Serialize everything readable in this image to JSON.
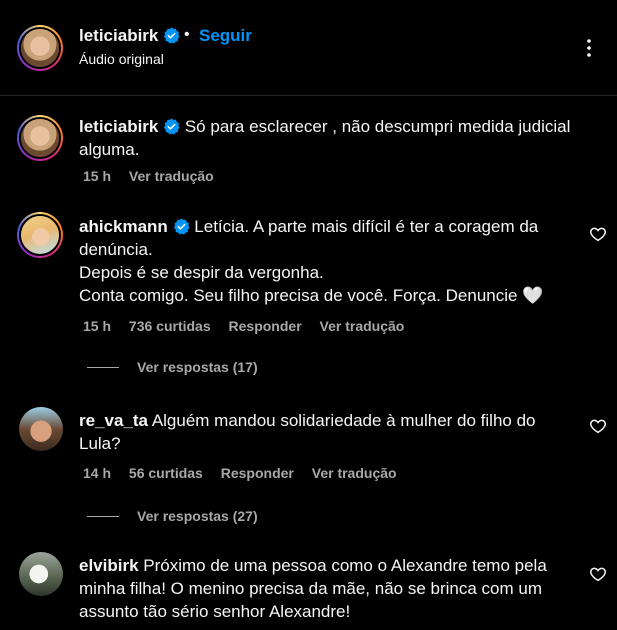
{
  "header": {
    "username": "leticiabirk",
    "follow_label": "Seguir",
    "separator": "•",
    "subtitle": "Áudio original",
    "verified_icon": "verified-badge-icon",
    "more_icon": "more-options-icon"
  },
  "comments": [
    {
      "username": "leticiabirk",
      "verified": true,
      "text": "Só para esclarecer , não descumpri medida judicial alguma.",
      "time": "15 h",
      "likes": "",
      "reply_label": "",
      "translate_label": "Ver tradução",
      "replies_label": ""
    },
    {
      "username": "ahickmann",
      "verified": true,
      "text": "Letícia. A parte mais difícil é ter a coragem da denúncia.\nDepois é se despir da vergonha.\nConta comigo. Seu filho precisa de você. Força. Denuncie 🤍",
      "time": "15 h",
      "likes": "736 curtidas",
      "reply_label": "Responder",
      "translate_label": "Ver tradução",
      "replies_label": "Ver respostas (17)"
    },
    {
      "username": "re_va_ta",
      "verified": false,
      "text": "Alguém mandou solidariedade à mulher do filho do Lula?",
      "time": "14 h",
      "likes": "56 curtidas",
      "reply_label": "Responder",
      "translate_label": "Ver tradução",
      "replies_label": "Ver respostas (27)"
    },
    {
      "username": "elvibirk",
      "verified": false,
      "text": "Próximo de uma pessoa como o Alexandre temo pela minha filha! O menino precisa da mãe, não se brinca com um assunto tão sério senhor Alexandre!",
      "time": "",
      "likes": "",
      "reply_label": "",
      "translate_label": "",
      "replies_label": ""
    }
  ],
  "colors": {
    "background": "#000000",
    "text": "#f5f5f5",
    "muted": "#a8a8a8",
    "link_blue": "#0095f6",
    "verified_blue": "#0095f6"
  }
}
